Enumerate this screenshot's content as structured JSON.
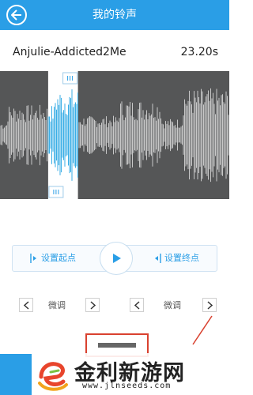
{
  "header": {
    "title": "我的铃声",
    "back_icon": "back-arrow-icon",
    "bg_color": "#2a9ee6"
  },
  "song": {
    "name": "Anjulie-Addicted2Me",
    "duration": "23.20s"
  },
  "waveform": {
    "selection_color": "#3aaee6",
    "wave_color": "#c8c8c8",
    "bg_color": "#555657",
    "selection_start_fraction": 0.21,
    "selection_end_fraction": 0.34
  },
  "controls": {
    "set_start_label": "设置起点",
    "set_end_label": "设置终点",
    "play_icon": "play-icon"
  },
  "fine_tune": {
    "left_label": "微调",
    "right_label": "微调"
  },
  "watermark": {
    "text": "金利新游网",
    "url": "www.jlnseeds.com"
  }
}
